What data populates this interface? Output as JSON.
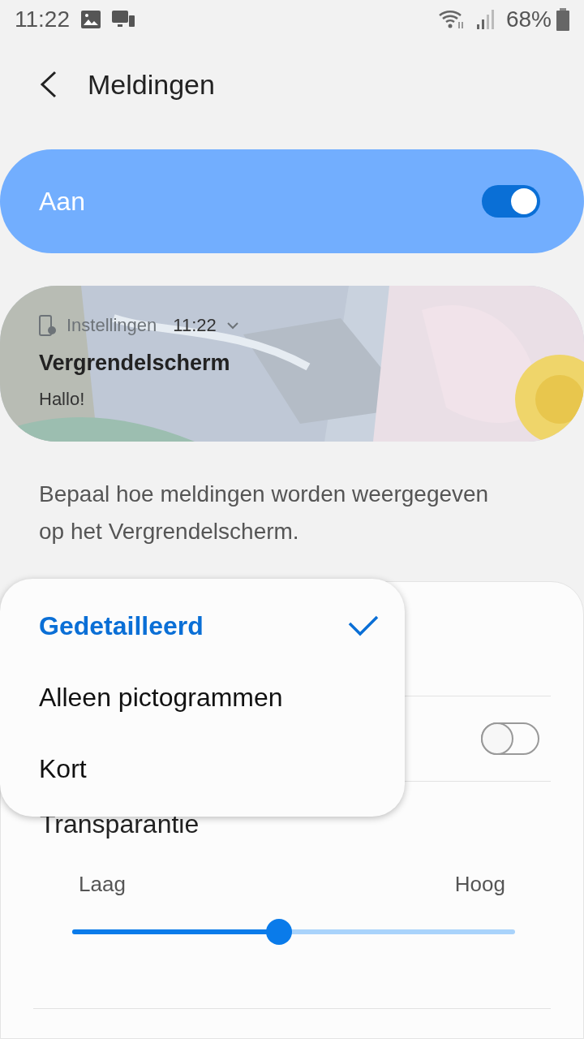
{
  "status_bar": {
    "time": "11:22",
    "battery": "68%"
  },
  "header": {
    "title": "Meldingen"
  },
  "master_switch": {
    "label": "Aan",
    "on": true
  },
  "preview": {
    "app": "Instellingen",
    "time": "11:22",
    "title": "Vergrendelscherm",
    "message": "Hallo!"
  },
  "description": "Bepaal hoe meldingen worden weergegeven op het Vergrendelscherm.",
  "menu": [
    {
      "label": "Gedetailleerd",
      "selected": true
    },
    {
      "label": "Alleen pictogrammen",
      "selected": false
    },
    {
      "label": "Kort",
      "selected": false
    }
  ],
  "hidden_toggle": {
    "on": false
  },
  "transparency": {
    "title": "Transparantie",
    "low": "Laag",
    "high": "Hoog",
    "level": 0.467
  }
}
